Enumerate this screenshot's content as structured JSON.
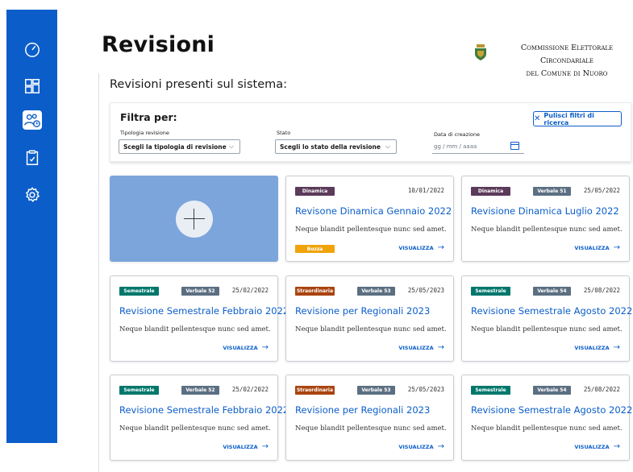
{
  "header": {
    "title": "Revisioni",
    "commission_line1": "Commissione Elettorale Circondariale",
    "commission_line2": "del Comune di Nuoro"
  },
  "sidebar": {
    "items": [
      {
        "icon": "dashboard-gauge-icon",
        "active": false
      },
      {
        "icon": "grid-layout-icon",
        "active": false
      },
      {
        "icon": "users-clock-icon",
        "active": true
      },
      {
        "icon": "clipboard-check-icon",
        "active": false
      },
      {
        "icon": "gear-icon",
        "active": false
      }
    ]
  },
  "main": {
    "section_title": "Revisioni presenti sul sistema:"
  },
  "filter": {
    "title": "Filtra per:",
    "clear_label": "Pulisci filtri di ricerca",
    "type_label": "Tipologia revisione",
    "type_value": "Scegli la tipologia di revisione",
    "state_label": "Stato",
    "state_value": "Scegli lo stato della revisione",
    "date_label": "Data di creazione",
    "date_placeholder": "gg / mm / aaaa"
  },
  "colors": {
    "brand": "#0b5ec9",
    "dinamica": "#5b3a5a",
    "semestrale": "#00776b",
    "straordinaria": "#a94410",
    "verbale": "#5c6f82",
    "bozza": "#f0a30a"
  },
  "cards": [
    {
      "type": "Dinamica",
      "verbale": "",
      "date": "10/01/2022",
      "title": "Revisone Dinamica Gennaio 2022",
      "desc": "Neque blandit pellentesque nunc sed amet.",
      "status": "Bozza",
      "view": "VISUALIZZA"
    },
    {
      "type": "Dinamica",
      "verbale": "Verbale 51",
      "date": "25/05/2022",
      "title": "Revisione Dinamica Luglio 2022",
      "desc": "Neque blandit pellentesque nunc sed amet.",
      "status": "",
      "view": "VISUALIZZA"
    },
    {
      "type": "Semestrale",
      "verbale": "Verbale 52",
      "date": "25/02/2022",
      "title": "Revisione Semestrale Febbraio 2022",
      "desc": "Neque blandit pellentesque nunc sed amet.",
      "status": "",
      "view": "VISUALIZZA"
    },
    {
      "type": "Straordinaria",
      "verbale": "Verbale 53",
      "date": "25/05/2023",
      "title": "Revisione per Regionali 2023",
      "desc": "Neque blandit pellentesque nunc sed amet.",
      "status": "",
      "view": "VISUALIZZA"
    },
    {
      "type": "Semestrale",
      "verbale": "Verbale 54",
      "date": "25/08/2022",
      "title": "Revisione Semestrale Agosto 2022",
      "desc": "Neque blandit pellentesque nunc sed amet.",
      "status": "",
      "view": "VISUALIZZA"
    },
    {
      "type": "Semestrale",
      "verbale": "Verbale 52",
      "date": "25/02/2022",
      "title": "Revisione Semestrale Febbraio 2022",
      "desc": "Neque blandit pellentesque nunc sed amet.",
      "status": "",
      "view": "VISUALIZZA"
    },
    {
      "type": "Straordinaria",
      "verbale": "Verbale 53",
      "date": "25/05/2023",
      "title": "Revisione per Regionali 2023",
      "desc": "Neque blandit pellentesque nunc sed amet.",
      "status": "",
      "view": "VISUALIZZA"
    },
    {
      "type": "Semestrale",
      "verbale": "Verbale 54",
      "date": "25/08/2022",
      "title": "Revisione Semestrale Agosto 2022",
      "desc": "Neque blandit pellentesque nunc sed amet.",
      "status": "",
      "view": "VISUALIZZA"
    }
  ]
}
